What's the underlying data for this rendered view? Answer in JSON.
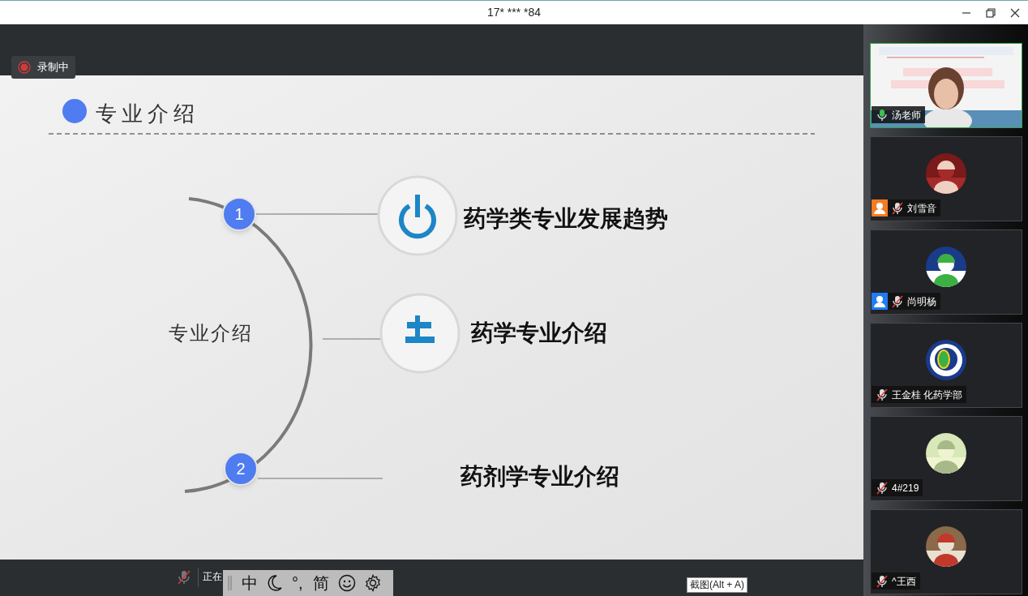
{
  "window": {
    "title": "17* *** *84"
  },
  "recording": {
    "label": "录制中",
    "on": true
  },
  "slide": {
    "title": "专业介绍",
    "center_label": "专业介绍",
    "nodes": [
      "1",
      "2"
    ],
    "items": [
      {
        "text": "药学类专业发展趋势",
        "kind": "power"
      },
      {
        "text": "药学专业介绍",
        "kind": "branch"
      },
      {
        "text": "药剂学专业介绍",
        "kind": "plain"
      }
    ]
  },
  "participants": [
    {
      "name": "汤老师",
      "muted": false,
      "speaking": true,
      "kind": "video"
    },
    {
      "name": "刘雪音",
      "muted": true,
      "speaking": false,
      "color": "#f47b20"
    },
    {
      "name": "尚明杨",
      "muted": true,
      "speaking": false,
      "color": "#1f7cf2"
    },
    {
      "name": "王金桂 化药学部",
      "muted": true,
      "speaking": false,
      "kind": "logo"
    },
    {
      "name": "4#219",
      "muted": true,
      "speaking": false
    },
    {
      "name": "^王西",
      "muted": true,
      "speaking": false
    }
  ],
  "bottom_bar": {
    "mic_muted": true,
    "status_text": "正在"
  },
  "ime_toolbar": {
    "mode": "中",
    "punctuation": "°,",
    "script": "简"
  },
  "tooltip": {
    "text": "截图(Alt + A)"
  }
}
